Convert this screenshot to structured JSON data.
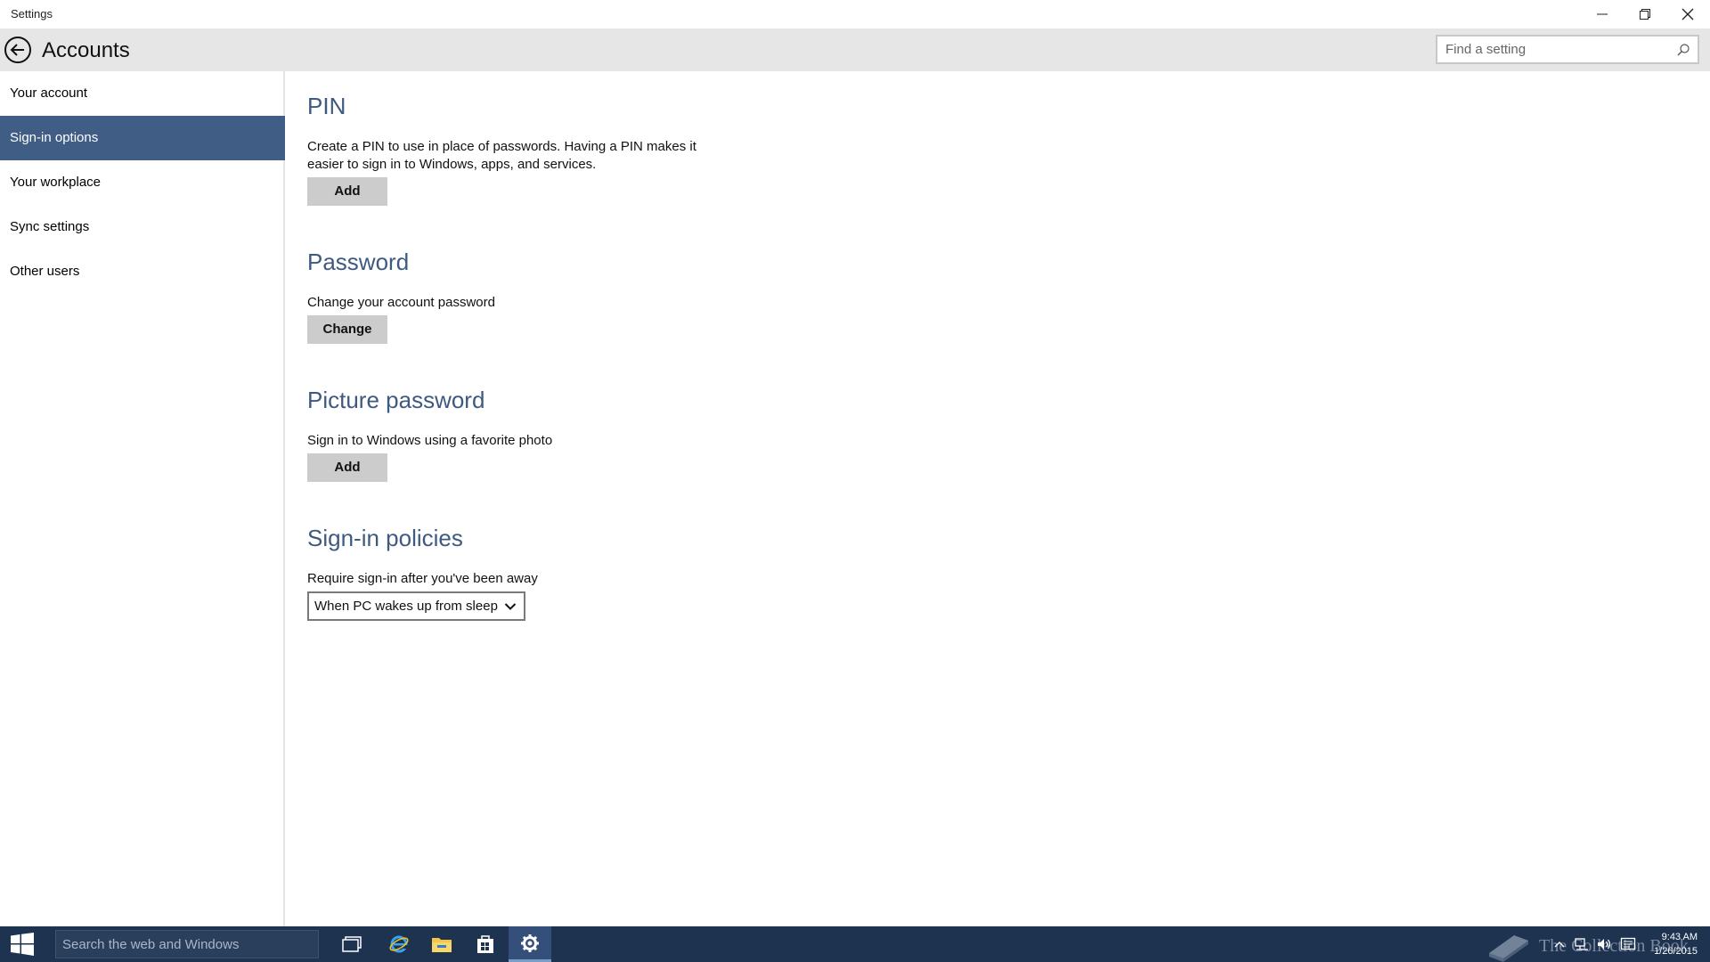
{
  "window": {
    "title": "Settings"
  },
  "header": {
    "title": "Accounts",
    "search_placeholder": "Find a setting"
  },
  "sidebar": {
    "items": [
      {
        "label": "Your account",
        "selected": false
      },
      {
        "label": "Sign-in options",
        "selected": true
      },
      {
        "label": "Your workplace",
        "selected": false
      },
      {
        "label": "Sync settings",
        "selected": false
      },
      {
        "label": "Other users",
        "selected": false
      }
    ]
  },
  "sections": {
    "pin": {
      "title": "PIN",
      "description": "Create a PIN to use in place of passwords. Having a PIN makes it easier to sign in to Windows, apps, and services.",
      "button": "Add"
    },
    "password": {
      "title": "Password",
      "description": "Change your account password",
      "button": "Change"
    },
    "picture_password": {
      "title": "Picture password",
      "description": "Sign in to Windows using a favorite photo",
      "button": "Add"
    },
    "signin_policies": {
      "title": "Sign-in policies",
      "description": "Require sign-in after you've been away",
      "dropdown_value": "When PC wakes up from sleep"
    }
  },
  "taskbar": {
    "search_placeholder": "Search the web and Windows",
    "watermark": "The Collection Book",
    "time": "9:43 AM",
    "date": "1/26/2015"
  },
  "colors": {
    "accent": "#3f5d85",
    "section_title": "#3e5a80",
    "taskbar": "#1d3350",
    "header_bg": "#e6e6e6"
  },
  "icons": {
    "back": "back-arrow-icon",
    "search": "search-icon",
    "start": "windows-logo-icon",
    "task_view": "task-view-icon",
    "browser": "internet-explorer-icon",
    "file_explorer": "folder-icon",
    "store": "store-icon",
    "settings": "gear-icon"
  }
}
